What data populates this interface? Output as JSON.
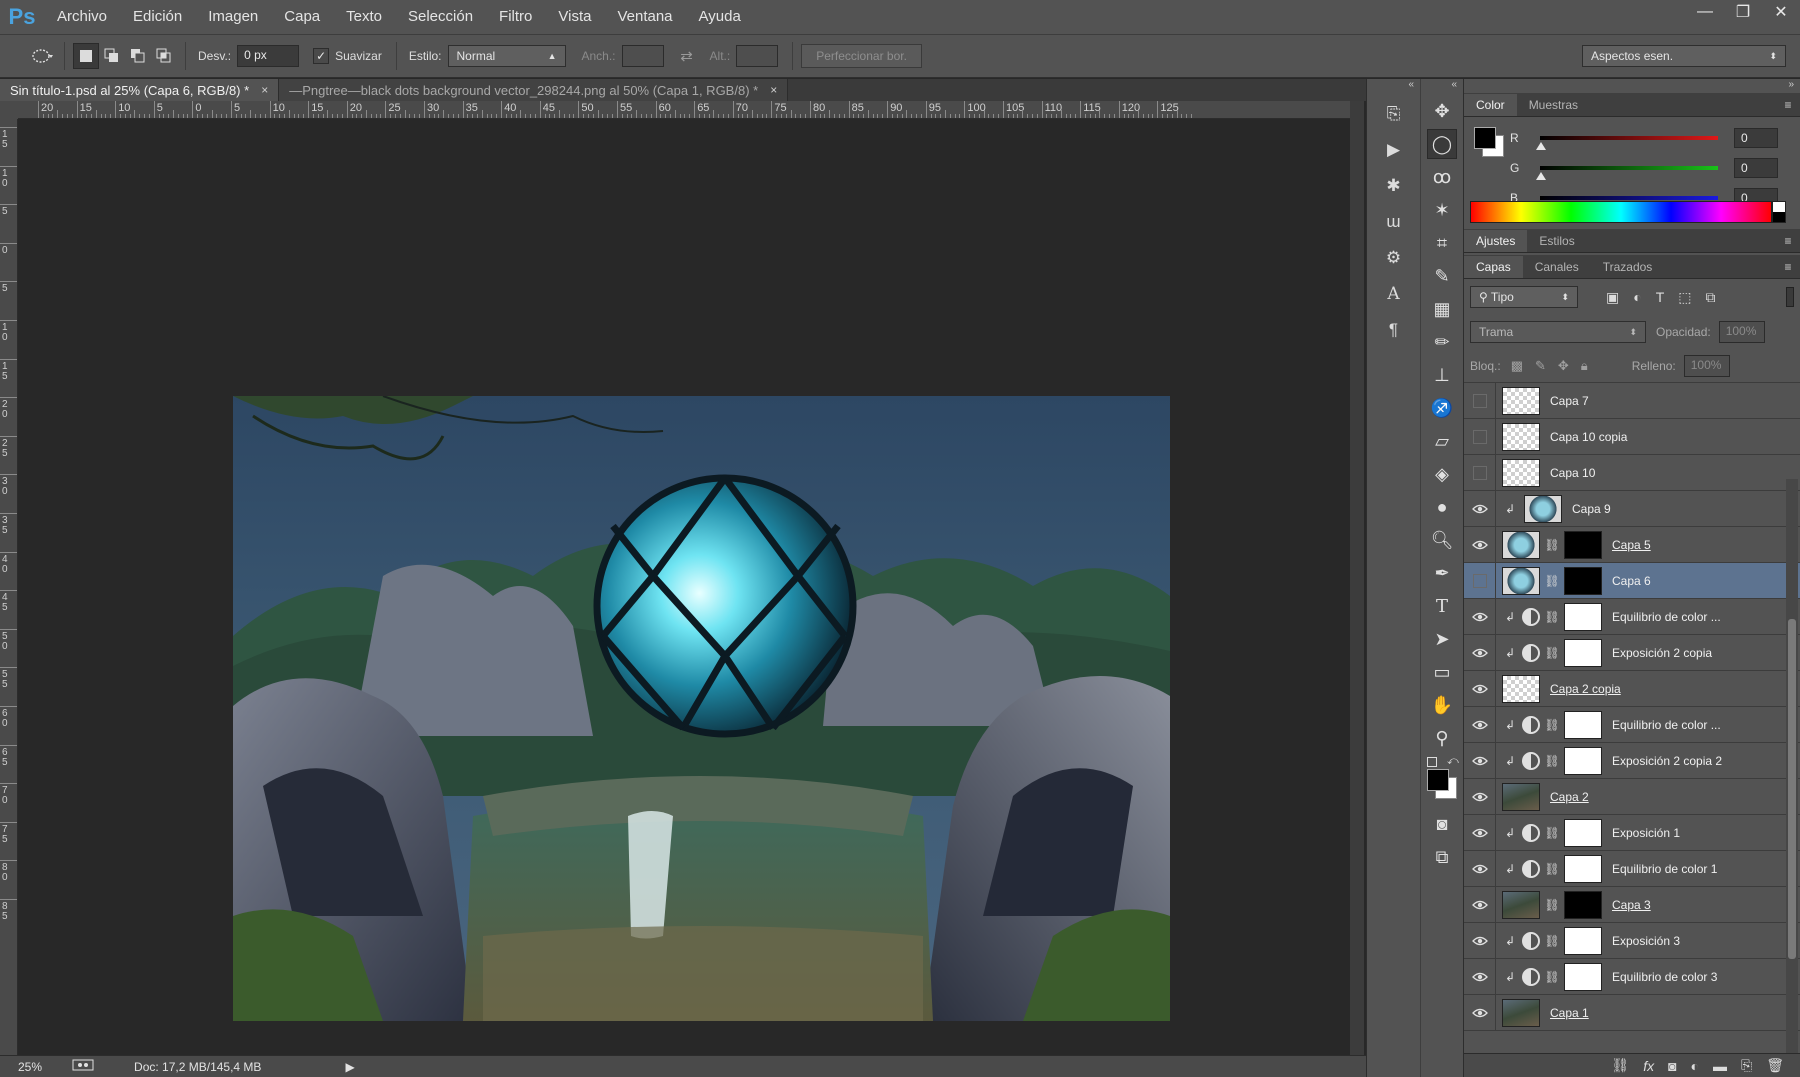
{
  "app": {
    "logo": "Ps"
  },
  "menu": [
    "Archivo",
    "Edición",
    "Imagen",
    "Capa",
    "Texto",
    "Selección",
    "Filtro",
    "Vista",
    "Ventana",
    "Ayuda"
  ],
  "window_controls": {
    "minimize": "—",
    "restore": "❐",
    "close": "✕"
  },
  "options": {
    "desv_label": "Desv.:",
    "desv_value": "0 px",
    "suavizar_label": "Suavizar",
    "suavizar_checked": "✓",
    "estilo_label": "Estilo:",
    "estilo_value": "Normal",
    "anch_label": "Anch.:",
    "alt_label": "Alt.:",
    "refine_button": "Perfeccionar bor.",
    "workspace_select": "Aspectos esen."
  },
  "tabs": [
    {
      "title": "Sin título-1.psd al 25% (Capa 6, RGB/8) *",
      "close": "×"
    },
    {
      "title": "—Pngtree—black dots background vector_298244.png al 50% (Capa 1, RGB/8) *",
      "close": "×"
    }
  ],
  "ruler_h_labels": [
    "20",
    "15",
    "10",
    "5",
    "0",
    "5",
    "10",
    "15",
    "20",
    "25",
    "30",
    "35",
    "40",
    "45",
    "50",
    "55",
    "60",
    "65",
    "70",
    "75",
    "80",
    "85",
    "90",
    "95",
    "100",
    "105",
    "110",
    "115",
    "120",
    "125"
  ],
  "ruler_v_labels": [
    "1 5",
    "1 0",
    "5",
    "0",
    "5",
    "1 0",
    "1 5",
    "2 0",
    "2 5",
    "3 0",
    "3 5",
    "4 0",
    "4 5",
    "5 0",
    "5 5",
    "6 0",
    "6 5",
    "7 0",
    "7 5",
    "8 0",
    "8 5"
  ],
  "status": {
    "zoom": "25%",
    "doc": "Doc: 17,2 MB/145,4 MB"
  },
  "color_panel": {
    "tabs": [
      "Color",
      "Muestras"
    ],
    "channels": [
      {
        "label": "R",
        "value": "0",
        "color": "#e01818"
      },
      {
        "label": "G",
        "value": "0",
        "color": "#19c219"
      },
      {
        "label": "B",
        "value": "0",
        "color": "#1a1ae0"
      }
    ]
  },
  "adjust_panel": {
    "tabs": [
      "Ajustes",
      "Estilos"
    ]
  },
  "layers_panel": {
    "tabs": [
      "Capas",
      "Canales",
      "Trazados"
    ],
    "filter": "Tipo",
    "blend_mode": "Trama",
    "opacity_label": "Opacidad:",
    "opacity_value": "100%",
    "lock_label": "Bloq.:",
    "fill_label": "Relleno:",
    "fill_value": "100%",
    "layers": [
      {
        "name": "Capa 7",
        "visible": false,
        "type": "pixel"
      },
      {
        "name": "Capa 10 copia",
        "visible": false,
        "type": "pixel"
      },
      {
        "name": "Capa 10",
        "visible": false,
        "type": "pixel"
      },
      {
        "name": "Capa 9",
        "visible": true,
        "type": "clip-pixel"
      },
      {
        "name": "Capa 5",
        "visible": true,
        "type": "masked",
        "underline": true
      },
      {
        "name": "Capa 6",
        "visible": false,
        "type": "masked",
        "selected": true
      },
      {
        "name": "Equilibrio de color ...",
        "visible": true,
        "type": "adjust"
      },
      {
        "name": "Exposición 2 copia",
        "visible": true,
        "type": "adjust"
      },
      {
        "name": "Capa 2 copia",
        "visible": true,
        "type": "pixel",
        "underline": true
      },
      {
        "name": "Equilibrio de color ...",
        "visible": true,
        "type": "adjust"
      },
      {
        "name": "Exposición 2 copia 2",
        "visible": true,
        "type": "adjust"
      },
      {
        "name": "Capa 2",
        "visible": true,
        "type": "photo",
        "underline": true
      },
      {
        "name": "Exposición 1",
        "visible": true,
        "type": "adjust"
      },
      {
        "name": "Equilibrio de color 1",
        "visible": true,
        "type": "adjust"
      },
      {
        "name": "Capa 3",
        "visible": true,
        "type": "masked-photo",
        "underline": true
      },
      {
        "name": "Exposición 3",
        "visible": true,
        "type": "adjust"
      },
      {
        "name": "Equilibrio de color 3",
        "visible": true,
        "type": "adjust"
      },
      {
        "name": "Capa 1",
        "visible": true,
        "type": "photo",
        "underline": true
      }
    ]
  }
}
